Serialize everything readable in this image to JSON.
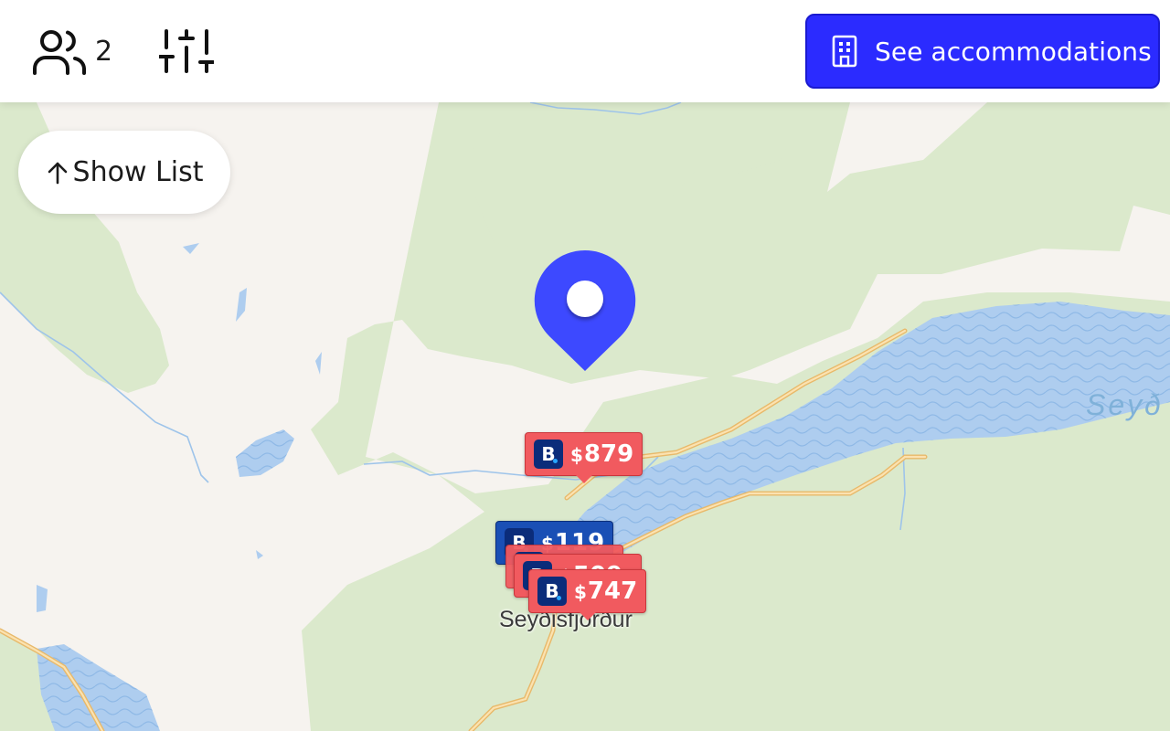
{
  "header": {
    "guests_icon": "users-icon",
    "guests_count": "2",
    "filters_icon": "sliders-icon",
    "cta_icon": "building-icon",
    "cta_label": "See accommodations",
    "cta_color": "#2b2bff"
  },
  "map": {
    "show_list_icon": "arrow-up-icon",
    "show_list_label": "Show List",
    "location_pin_icon": "map-pin-icon",
    "pin_color": "#3d49ff",
    "town_label": "Seyðisfjörður",
    "fjord_label": "Seyð",
    "markers": [
      {
        "icon": "booking-icon",
        "logo": "B",
        "currency": "$",
        "price": "119",
        "color": "#1a4fb5"
      },
      {
        "icon": "booking-icon",
        "logo": "B",
        "currency": "$",
        "price": "509",
        "color": "#f15a5f"
      },
      {
        "icon": "booking-icon",
        "logo": "B",
        "currency": "$",
        "price": "747",
        "color": "#f15a5f"
      },
      {
        "icon": "booking-icon",
        "logo": "B",
        "currency": "$",
        "price": "879",
        "color": "#f15a5f"
      }
    ]
  }
}
